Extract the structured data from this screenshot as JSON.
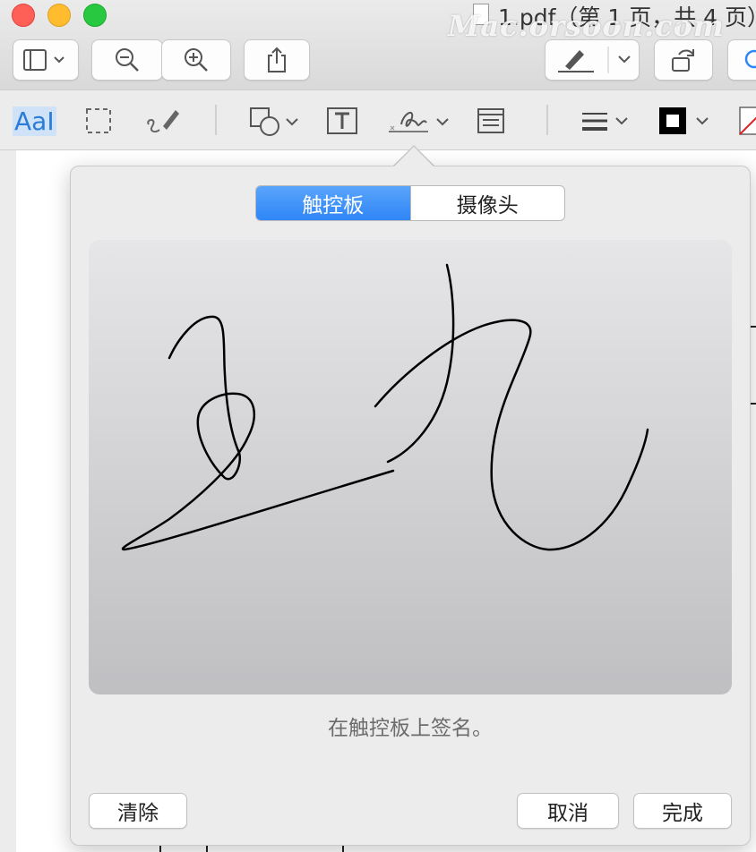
{
  "window": {
    "title": "1.pdf（第 1 页，共 4 页）",
    "watermark": "Mac.orsoon.com"
  },
  "toolbar": {
    "buttons": [
      "sidebar-toggle",
      "zoom-out",
      "zoom-in",
      "share",
      "markup-pen",
      "rotate"
    ]
  },
  "markup": {
    "text_tool_label": "AaI",
    "tools": [
      "text-selection",
      "rect-selection",
      "sketch",
      "shapes",
      "text-box",
      "sign",
      "note",
      "line-style",
      "border-color",
      "fill-color"
    ]
  },
  "popover": {
    "tabs": [
      {
        "label": "触控板",
        "selected": true
      },
      {
        "label": "摄像头",
        "selected": false
      }
    ],
    "hint": "在触控板上签名。",
    "clear_label": "清除",
    "cancel_label": "取消",
    "done_label": "完成",
    "accent_color": "#2f86f6"
  }
}
